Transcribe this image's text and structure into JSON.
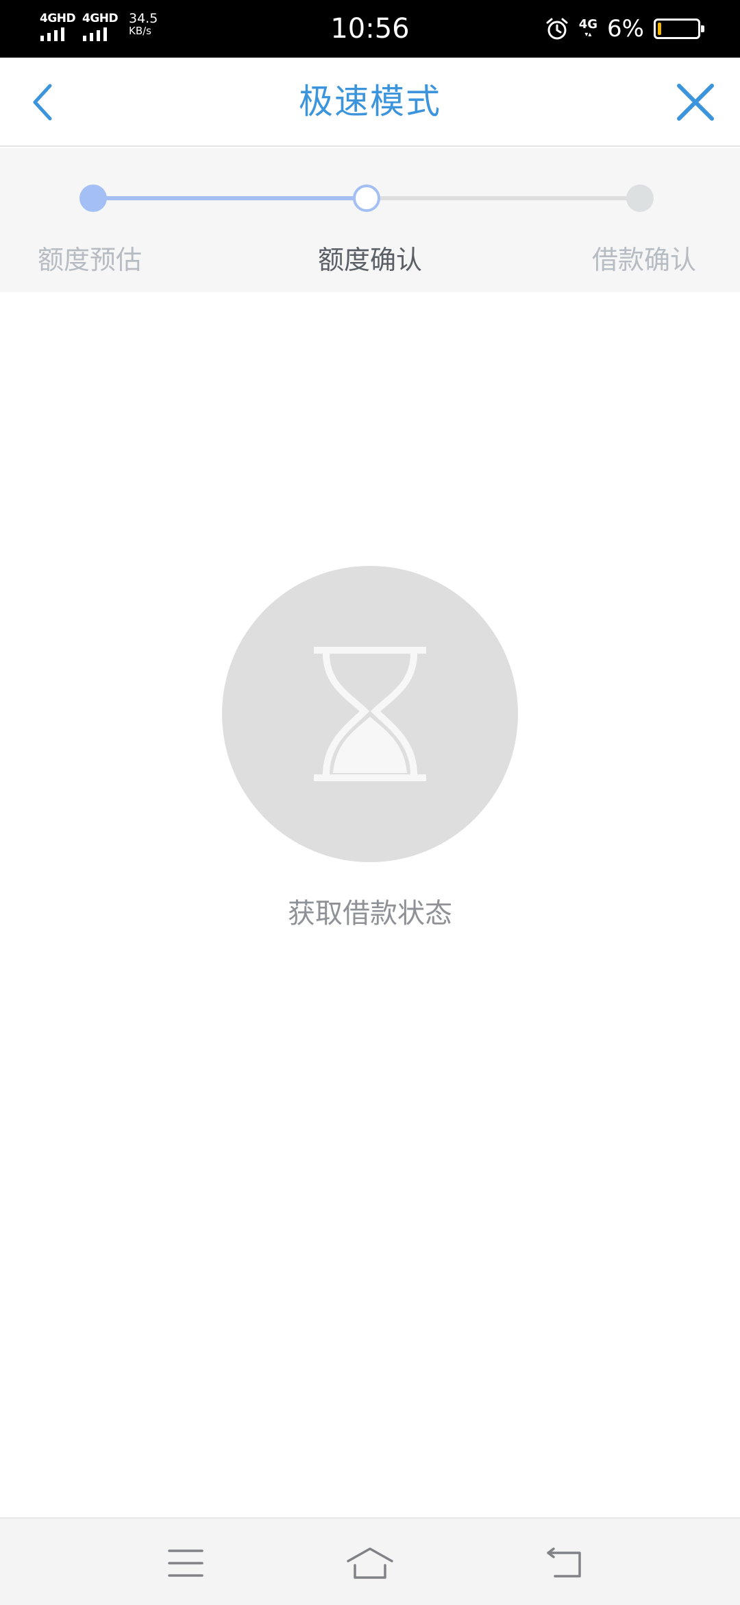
{
  "status_bar": {
    "sim1_label": "4GHD",
    "sim2_label": "4GHD",
    "speed_value": "34.5",
    "speed_unit": "KB/s",
    "time": "10:56",
    "network_right": "4G",
    "battery_percent_text": "6%",
    "battery_level": 0.06,
    "battery_color": "#f5b800"
  },
  "header": {
    "title": "极速模式",
    "back_icon": "chevron-left-icon",
    "close_icon": "close-icon",
    "accent_color": "#3c95dc"
  },
  "steps": {
    "current_index": 1,
    "items": [
      {
        "label": "额度预估",
        "state": "done"
      },
      {
        "label": "额度确认",
        "state": "current"
      },
      {
        "label": "借款确认",
        "state": "pending"
      }
    ],
    "active_color": "#a4bff4",
    "pending_color": "#dedede"
  },
  "main": {
    "icon": "hourglass-icon",
    "status_text": "获取借款状态"
  },
  "nav_bar": {
    "items": [
      {
        "icon": "menu-icon"
      },
      {
        "icon": "home-icon"
      },
      {
        "icon": "back-icon"
      }
    ]
  }
}
